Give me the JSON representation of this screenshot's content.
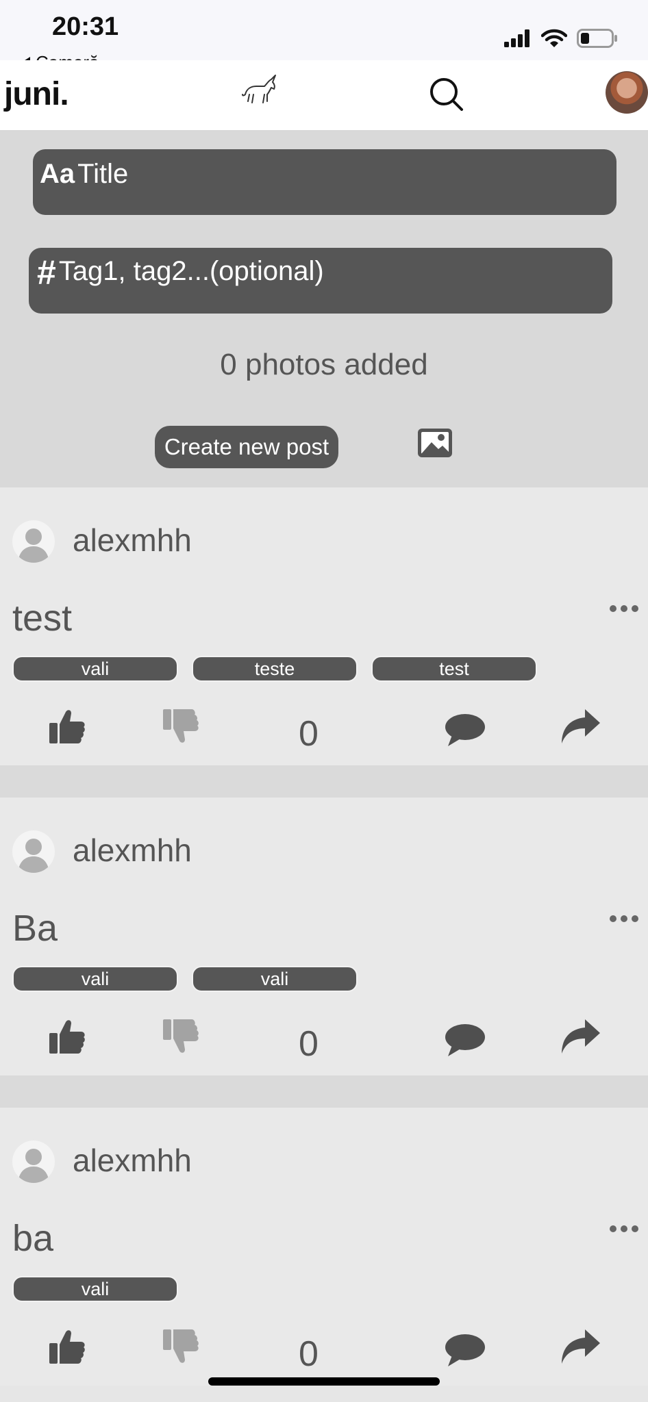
{
  "status_bar": {
    "time": "20:31",
    "back_label": "Cameră"
  },
  "header": {
    "brand": "juni."
  },
  "composer": {
    "title_prefix": "Aa",
    "title_placeholder": "Title",
    "tags_prefix": "#",
    "tags_placeholder": "Tag1, tag2...(optional)",
    "photos_count": "0 photos added",
    "create_label": "Create new post"
  },
  "posts": [
    {
      "username": "alexmhh",
      "title": "test",
      "tags": [
        "vali",
        "teste",
        "test"
      ],
      "score": "0"
    },
    {
      "username": "alexmhh",
      "title": "Ba",
      "tags": [
        "vali",
        "vali"
      ],
      "score": "0"
    },
    {
      "username": "alexmhh",
      "title": "ba",
      "tags": [
        "vali"
      ],
      "score": "0"
    }
  ],
  "colors": {
    "dark_pill": "#565656",
    "composer_bg": "#d9d9d9",
    "post_bg": "#e9e9e9",
    "dislike_icon": "#a3a3a3"
  }
}
